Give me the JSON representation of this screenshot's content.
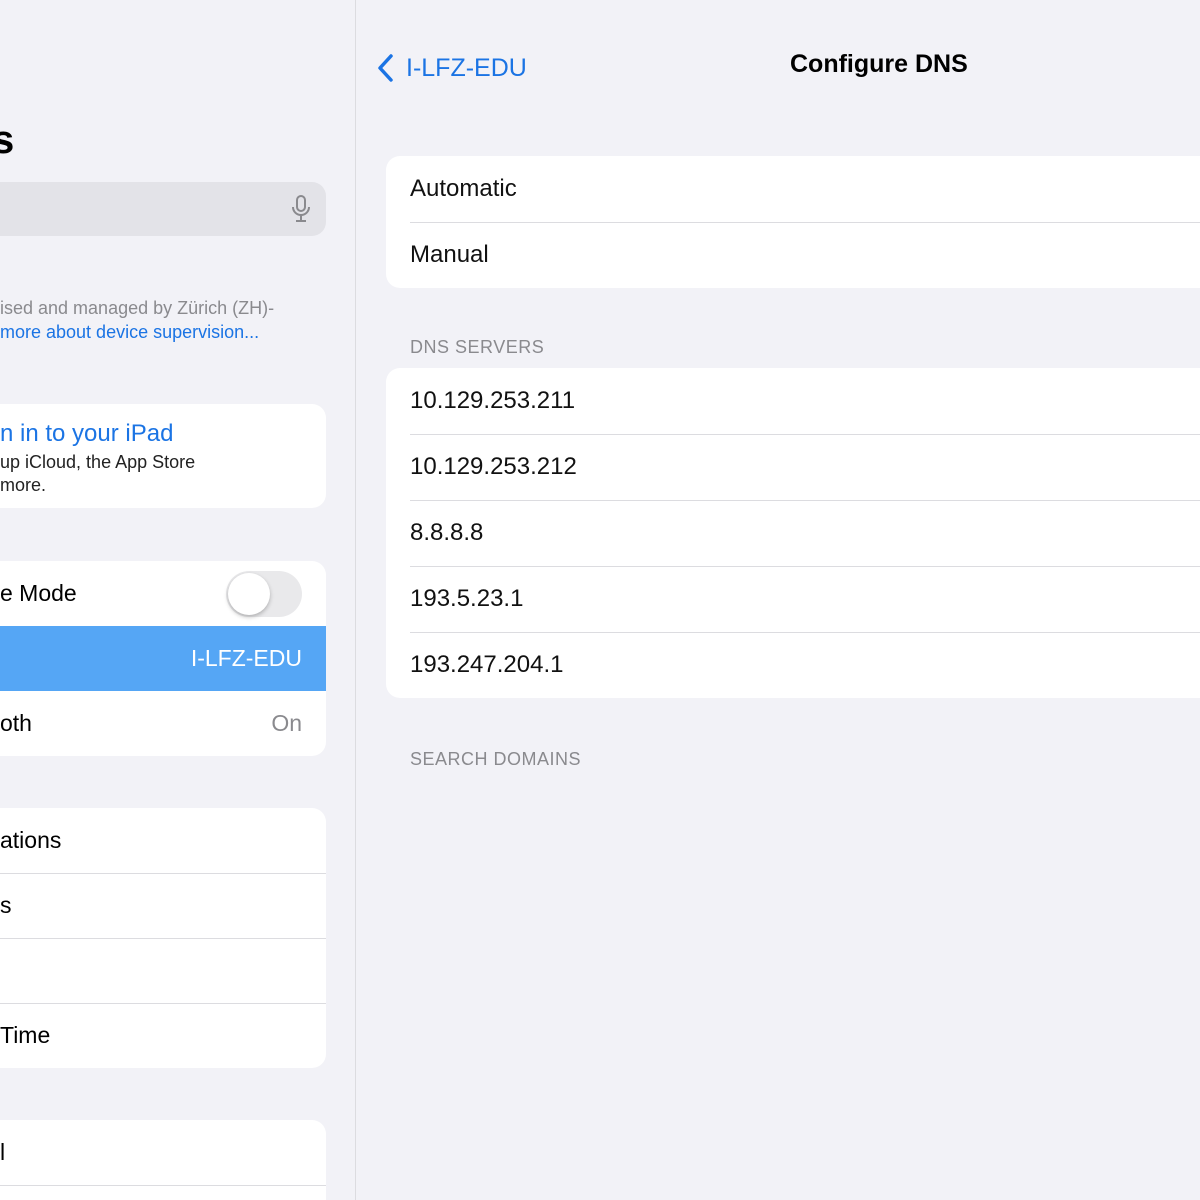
{
  "sidebar": {
    "title": "s",
    "supervision_text": "ised and managed by Zürich (ZH)-",
    "supervision_link": "more about device supervision...",
    "signin": {
      "title": "n in to your iPad",
      "subtitle_line1": "up iCloud, the App Store",
      "subtitle_line2": " more."
    },
    "connectivity": [
      {
        "label": "e Mode",
        "type": "toggle",
        "on": false
      },
      {
        "label": "",
        "value": "I-LFZ-EDU",
        "selected": true
      },
      {
        "label": "oth",
        "value": "On"
      }
    ],
    "general_items": [
      "ations",
      "s",
      "",
      " Time"
    ],
    "bottom_items": [
      "l"
    ]
  },
  "detail": {
    "back_label": "I-LFZ-EDU",
    "title": "Configure DNS",
    "modes": [
      "Automatic",
      "Manual"
    ],
    "dns_header": "DNS SERVERS",
    "dns_servers": [
      "10.129.253.211",
      "10.129.253.212",
      "8.8.8.8",
      "193.5.23.1",
      "193.247.204.1"
    ],
    "search_header": "SEARCH DOMAINS"
  },
  "colors": {
    "accent": "#1b74e4",
    "selected_row": "#55a6f5",
    "background": "#f2f2f7"
  }
}
